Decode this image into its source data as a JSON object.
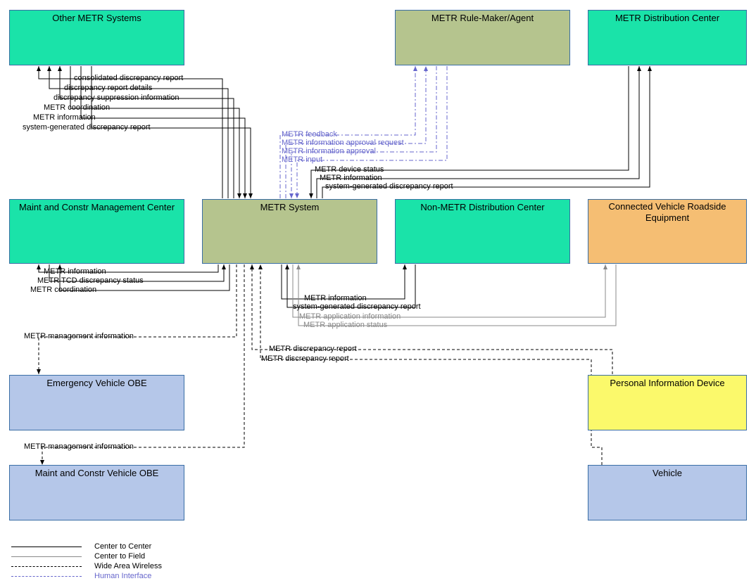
{
  "boxes": {
    "other_metr": "Other METR Systems",
    "rule_maker": "METR Rule-Maker/Agent",
    "dist_center": "METR Distribution Center",
    "maint_center": "Maint and Constr Management Center",
    "metr_system": "METR System",
    "nonmetr_dist": "Non-METR Distribution Center",
    "cvre": "Connected Vehicle Roadside Equipment",
    "ev_obe": "Emergency Vehicle OBE",
    "pid": "Personal Information Device",
    "mc_obe": "Maint and Constr Vehicle OBE",
    "vehicle": "Vehicle"
  },
  "flows": {
    "other_cdr": "consolidated discrepancy report",
    "other_drd": "discrepancy report details",
    "other_dsi": "discrepancy suppression information",
    "other_mc": "METR coordination",
    "other_mi": "METR information",
    "other_sgdr": "system-generated discrepancy report",
    "rule_fb": "METR feedback",
    "rule_iar": "METR information approval request",
    "rule_ia": "METR information approval",
    "rule_input": "METR input",
    "dist_mds": "METR device status",
    "dist_mi": "METR information",
    "dist_sgdr": "system-generated discrepancy report",
    "maint_mi": "METR information",
    "maint_tcd": "METR TCD discrepancy status",
    "maint_mc": "METR coordination",
    "nonmetr_mi": "METR information",
    "nonmetr_sgdr": "system-generated discrepancy report",
    "cvre_ai": "METR application information",
    "cvre_as": "METR application status",
    "ev_mmi": "METR management information",
    "mc_mmi": "METR management information",
    "pid_mdr": "METR discrepancy report",
    "veh_mdr": "METR discrepancy report"
  },
  "legend": {
    "c2c": "Center to Center",
    "c2f": "Center to Field",
    "waw": "Wide Area Wireless",
    "hi": "Human Interface"
  }
}
